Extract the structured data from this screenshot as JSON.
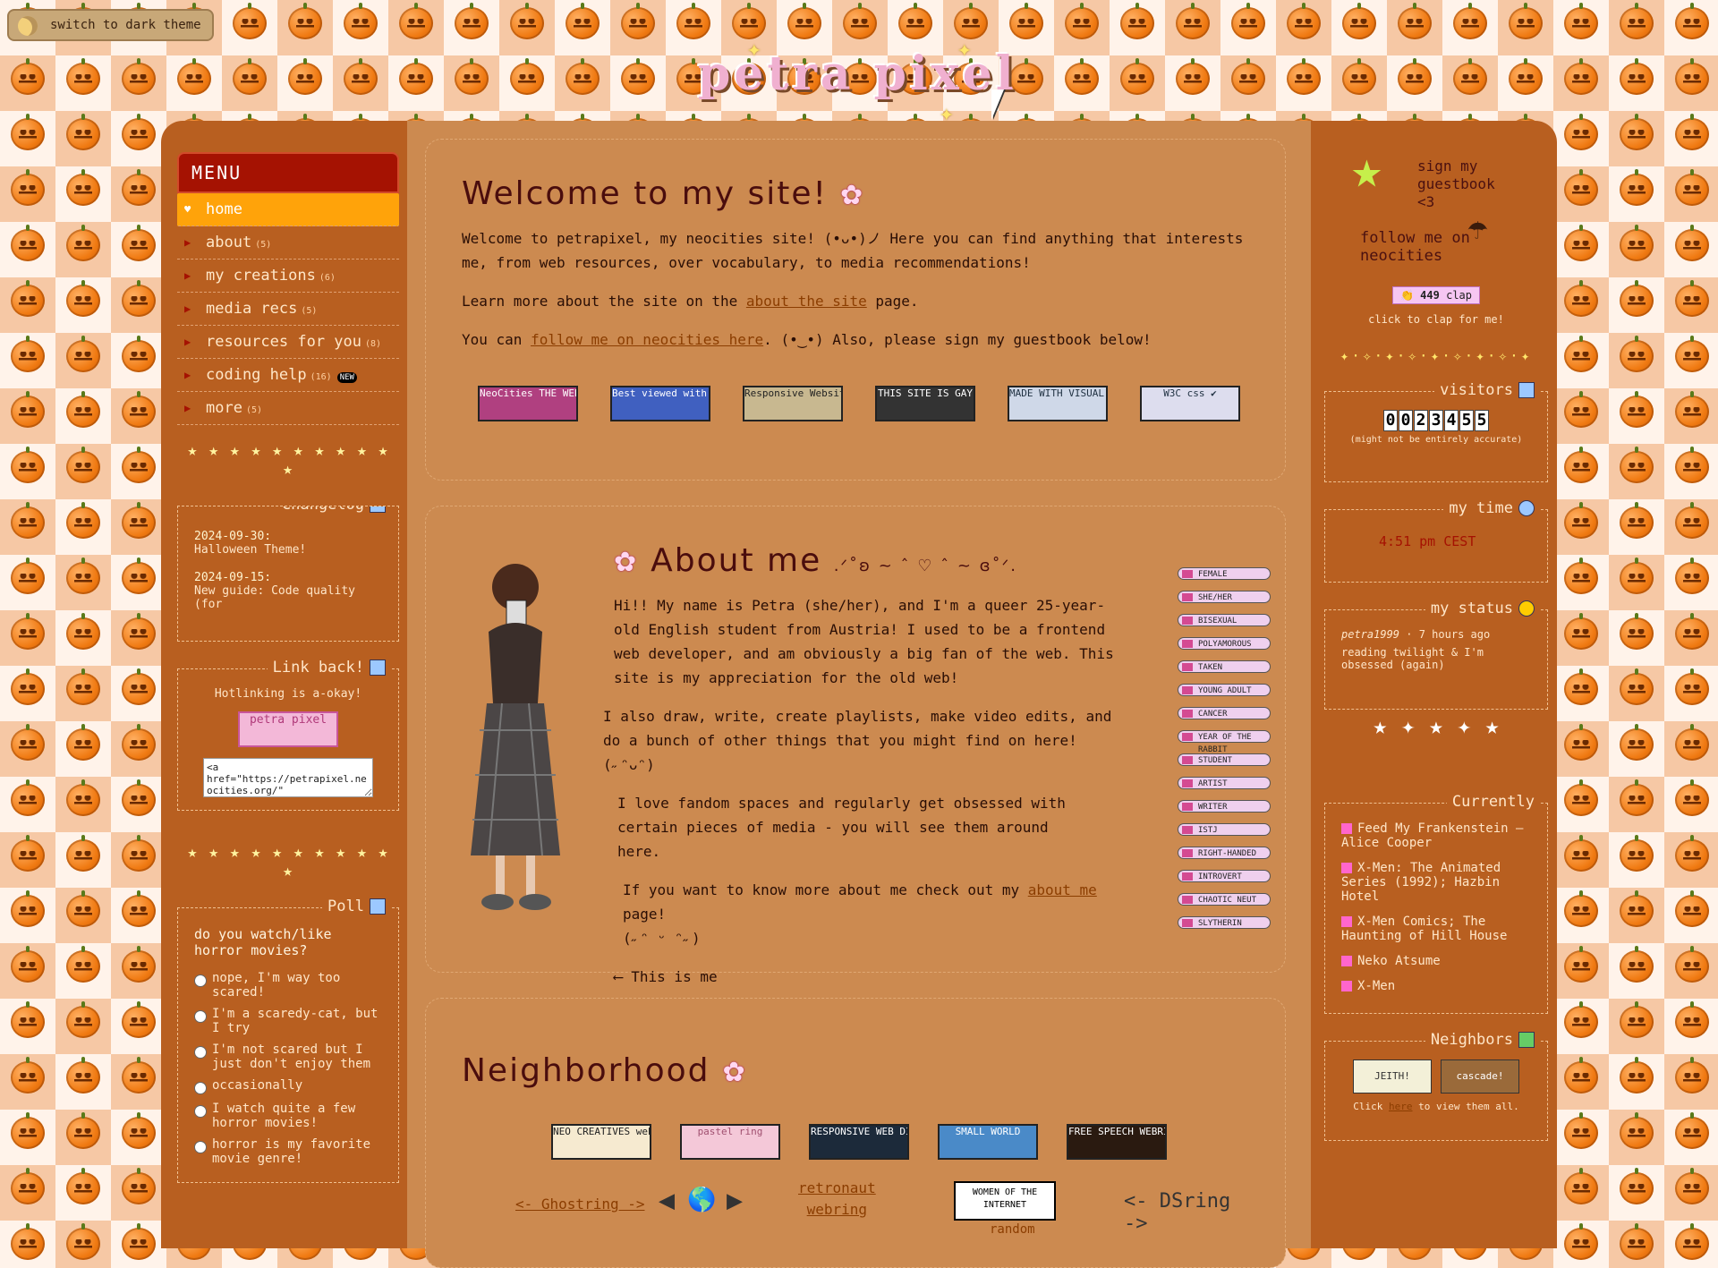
{
  "theme_toggle": "switch to dark theme",
  "logo": "petra pixel",
  "menu": {
    "title": "MENU",
    "items": [
      {
        "label": "home",
        "count": "",
        "active": true
      },
      {
        "label": "about",
        "count": "(5)"
      },
      {
        "label": "my creations",
        "count": "(6)"
      },
      {
        "label": "media recs",
        "count": "(5)"
      },
      {
        "label": "resources for you",
        "count": "(8)"
      },
      {
        "label": "coding help",
        "count": "(16)",
        "tag": "NEW"
      },
      {
        "label": "more",
        "count": "(5)"
      }
    ]
  },
  "changelog": {
    "title": "Changelog",
    "entries": [
      {
        "date": "2024-09-30:",
        "text": "Halloween Theme!"
      },
      {
        "date": "2024-09-15:",
        "text": "New guide: Code quality (for"
      }
    ]
  },
  "linkback": {
    "title": "Link back!",
    "text": "Hotlinking is a-okay!",
    "button": "petra pixel",
    "code": "<a href=\"https://petrapixel.neocities.org/\""
  },
  "poll": {
    "title": "Poll",
    "question": "do you watch/like horror movies?",
    "options": [
      "nope, I'm way too scared!",
      "I'm a scaredy-cat, but I try",
      "I'm not scared but I just don't enjoy them",
      "occasionally",
      "I watch quite a few horror movies!",
      "horror is my favorite movie genre!"
    ]
  },
  "welcome": {
    "title": "Welcome to my site!",
    "p1a": "Welcome to petrapixel, my neocities site!",
    "p1face": "(•ᴗ•)ノ",
    "p1b": "Here you can find anything that interests me, from web resources, over vocabulary, to media recommendations!",
    "p2a": "Learn more about the site on the",
    "p2link": "about the site",
    "p2b": "page.",
    "p3a": "You can",
    "p3link": "follow me on neocities here",
    "p3b": ".",
    "p3face": "(•‿•)",
    "p3c": "Also, please sign my guestbook below!",
    "buttons": [
      "NeoCities THE WEB IS YOURS",
      "Best viewed with A COMPUTER",
      "Responsive Website",
      "THIS SITE IS GAY",
      "MADE WITH VISUAL STUDIO CODE",
      "W3C css ✔"
    ]
  },
  "about": {
    "title": "About me",
    "deco": ".ᐟ˚ʚ ~ ˆ ♡ ˆ ~ ɞ˚ᐟ.",
    "p1": "Hi!! My name is Petra (she/her), and I'm a queer 25-year-old English student from Austria! I used to be a frontend web developer, and am obviously a big fan of the web. This site is my appreciation for the old web!",
    "p2": "I also draw, write, create playlists, make video edits, and do a bunch of other things that you might find on here!",
    "p2face": "(˶ᵔᴗᵔ)",
    "p3": "I love fandom spaces and regularly get obsessed with certain pieces of media - you will see them around here.",
    "p4a": "If you want to know more about me check out my",
    "p4link": "about me",
    "p4b": "page!",
    "p4face": "(˶ᵔ ᵕ ᵔ˶)",
    "caption": "⟵ This is me",
    "badges": [
      "FEMALE",
      "SHE/HER",
      "BISEXUAL",
      "POLYAMOROUS",
      "TAKEN",
      "YOUNG ADULT",
      "CANCER",
      "YEAR OF THE RABBIT",
      "STUDENT",
      "ARTIST",
      "WRITER",
      "ISTJ",
      "RIGHT-HANDED",
      "INTROVERT",
      "CHAOTIC NEUT",
      "SLYTHERIN"
    ]
  },
  "neighborhood": {
    "title": "Neighborhood",
    "webrings": [
      "NEO CREATIVES webring",
      "pastel ring",
      "RESPONSIVE WEB DIRECTORY",
      "SMALL WORLD",
      "FREE SPEECH WEBRING"
    ],
    "ring1": "<- Ghostring ->",
    "ring2a": "retronaut",
    "ring2b": "webring",
    "ring3": "WOMEN OF THE INTERNET",
    "ring3b": "random",
    "ring4": "<- DSring ->"
  },
  "right": {
    "guestbook": "sign my guestbook <3",
    "follow": "follow me on neocities",
    "clap_count": "449",
    "clap_label": "clap",
    "clap_hint": "click to clap for me!",
    "visitors_title": "visitors",
    "visitors": [
      "0",
      "0",
      "2",
      "3",
      "4",
      "5",
      "5"
    ],
    "visitors_note": "(might not be entirely accurate)",
    "time_title": "my time",
    "time": "4:51 pm CEST",
    "status_title": "my status",
    "status_user": "petra1999",
    "status_ago": "7 hours ago",
    "status_text": "reading twilight & I'm obsessed (again)",
    "currently_title": "Currently",
    "currently": [
      {
        "icon": "music-icon",
        "text": "Feed My Frankenstein – Alice Cooper"
      },
      {
        "icon": "tv-icon",
        "text": "X-Men: The Animated Series (1992); Hazbin Hotel"
      },
      {
        "icon": "book-icon",
        "text": "X-Men Comics; The Haunting of Hill House"
      },
      {
        "icon": "game-icon",
        "text": "Neko Atsume"
      },
      {
        "icon": "heart-icon",
        "text": "X-Men"
      }
    ],
    "neighbors_title": "Neighbors",
    "neighbors": [
      "JEITH!",
      "cascade!"
    ],
    "neighbors_note_a": "Click",
    "neighbors_link": "here",
    "neighbors_note_b": "to view them all."
  },
  "colors": {
    "accent": "#a51202",
    "active": "#ffa30a",
    "frame": "#b85f20",
    "content": "#cc8a50"
  }
}
